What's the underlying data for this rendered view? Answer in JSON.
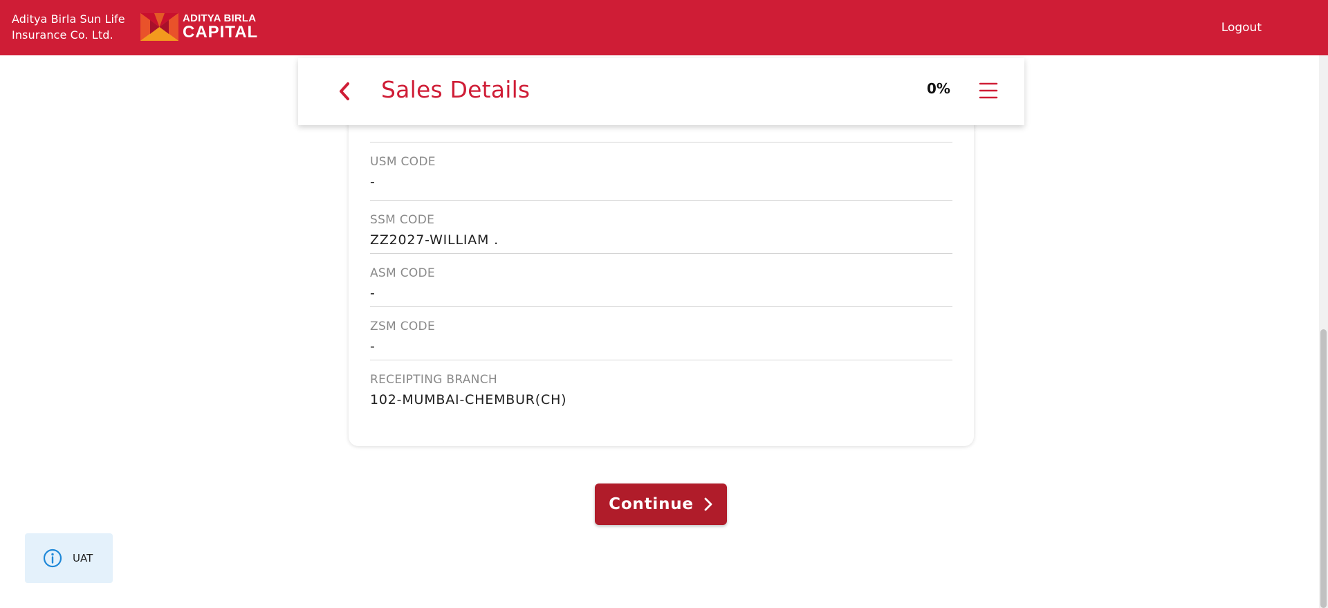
{
  "topbar": {
    "brand_line1": "Aditya Birla Sun Life",
    "brand_line2": "Insurance Co. Ltd.",
    "logo_top": "ADITYA BIRLA",
    "logo_bottom": "CAPITAL",
    "logout_label": "Logout",
    "bg_color": "#cf1d36"
  },
  "header": {
    "title": "Sales Details",
    "progress": "0%",
    "back_icon": "chevron-left-icon",
    "menu_icon": "hamburger-menu-icon"
  },
  "fields": [
    {
      "label": "USM CODE",
      "value": "-"
    },
    {
      "label": "SSM CODE",
      "value": "ZZ2027-WILLIAM ."
    },
    {
      "label": "ASM CODE",
      "value": "-"
    },
    {
      "label": "ZSM CODE",
      "value": "-"
    },
    {
      "label": "RECEIPTING BRANCH",
      "value": "102-MUMBAI-CHEMBUR(CH)"
    }
  ],
  "continue_button": {
    "label": "Continue",
    "icon": "chevron-right-icon",
    "color": "#b01c2a"
  },
  "env_badge": {
    "icon": "info-icon",
    "label": "UAT"
  }
}
